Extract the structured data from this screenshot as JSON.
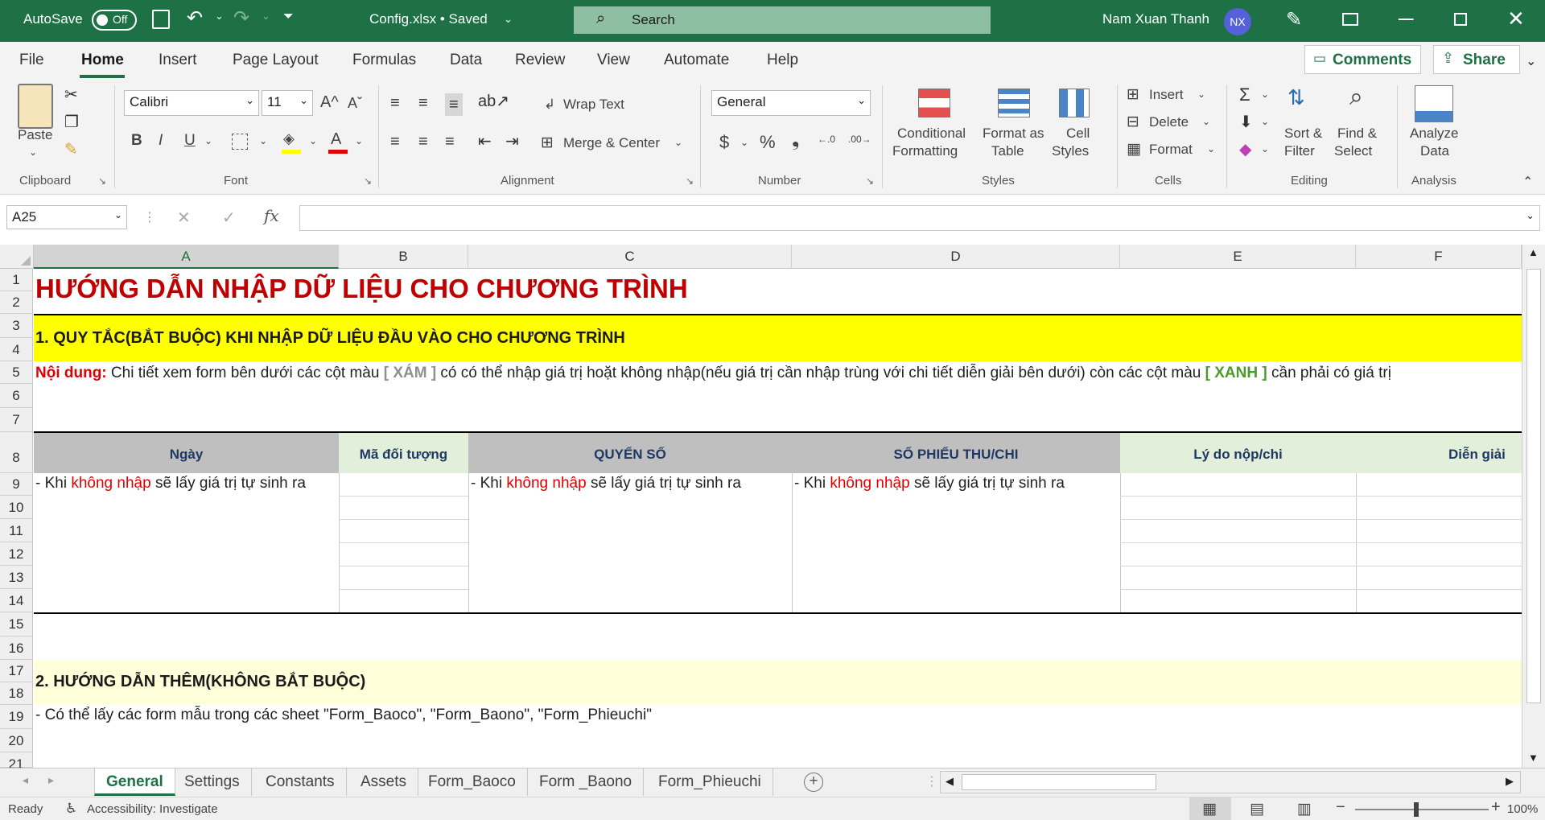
{
  "titlebar": {
    "autosave_label": "AutoSave",
    "autosave_state": "Off",
    "file_title": "Config.xlsx • Saved",
    "search_placeholder": "Search",
    "user_name": "Nam Xuan Thanh",
    "user_initials": "NX",
    "accent_color": "#1d7144"
  },
  "menu": [
    "File",
    "Home",
    "Insert",
    "Page Layout",
    "Formulas",
    "Data",
    "Review",
    "View",
    "Automate",
    "Help"
  ],
  "menu_active": "Home",
  "actions": {
    "comments": "Comments",
    "share": "Share"
  },
  "ribbon": {
    "clipboard": {
      "paste": "Paste",
      "label": "Clipboard"
    },
    "font": {
      "name": "Calibri",
      "size": "11",
      "label": "Font",
      "bold": "B",
      "italic": "I",
      "underline": "U"
    },
    "alignment": {
      "wrap_text": "Wrap Text",
      "merge_center": "Merge & Center",
      "label": "Alignment"
    },
    "number": {
      "format": "General",
      "label": "Number",
      "currency": "$",
      "percent": "%",
      "comma": "❟"
    },
    "styles": {
      "conditional_l1": "Conditional",
      "conditional_l2": "Formatting",
      "format_as_l1": "Format as",
      "format_as_l2": "Table",
      "cell_l1": "Cell",
      "cell_l2": "Styles",
      "label": "Styles"
    },
    "cells": {
      "insert": "Insert",
      "delete": "Delete",
      "format": "Format",
      "label": "Cells"
    },
    "editing": {
      "sort_l1": "Sort &",
      "sort_l2": "Filter",
      "find_l1": "Find &",
      "find_l2": "Select",
      "label": "Editing"
    },
    "analysis": {
      "analyze_l1": "Analyze",
      "analyze_l2": "Data",
      "label": "Analysis"
    }
  },
  "formula_bar": {
    "name_box": "A25",
    "fx": "fx",
    "value": ""
  },
  "columns": [
    "A",
    "B",
    "C",
    "D",
    "E",
    "F"
  ],
  "rows": [
    "1",
    "2",
    "3",
    "4",
    "5",
    "6",
    "7",
    "8",
    "9",
    "10",
    "11",
    "12",
    "13",
    "14",
    "15",
    "16",
    "17",
    "18",
    "19",
    "20",
    "21"
  ],
  "sheet": {
    "title": "HƯỚNG DẪN NHẬP DỮ LIỆU CHO CHƯƠNG TRÌNH",
    "section1": "1. QUY TẮC(BẮT BUỘC) KHI NHẬP DỮ LIỆU ĐẦU VÀO CHO CHƯƠNG TRÌNH",
    "content_label": "Nội dung:",
    "content_p1": " Chi tiết xem form bên dưới các cột màu ",
    "content_gray": "[ XÁM ]",
    "content_p2": " có có thể nhập giá trị hoặt không nhập(nếu giá trị cần nhập trùng với chi tiết diễn giải bên dưới) còn các cột màu ",
    "content_green": "[ XANH ]",
    "content_p3": " cần phải có giá trị",
    "headers": [
      "Ngày",
      "Mã đối tượng",
      "QUYỂN SỐ",
      "SỐ PHIẾU THU/CHI",
      "Lý do nộp/chi",
      "Diễn giải"
    ],
    "note_prefix": "- Khi ",
    "note_red": "không nhập",
    "note_suffix": " sẽ lấy giá trị tự sinh ra",
    "section2": "2. HƯỚNG DẪN THÊM(KHÔNG BẮT BUỘC)",
    "section2_line": "- Có thể lấy các form mẫu trong các sheet \"Form_Baoco\", \"Form_Baono\", \"Form_Phieuchi\"",
    "colors": {
      "title": "#c00000",
      "yellow": "#ffff00",
      "light_yellow": "#ffffd9",
      "gray_header": "#bfbfbf",
      "green_header": "#e2efda",
      "header_text": "#1f3864"
    }
  },
  "tabs": [
    "General",
    "Settings",
    "Constants",
    "Assets",
    "Form_Baoco",
    "Form _Baono",
    "Form_Phieuchi"
  ],
  "active_tab": "General",
  "status": {
    "ready": "Ready",
    "accessibility": "Accessibility: Investigate",
    "zoom": "100%"
  }
}
